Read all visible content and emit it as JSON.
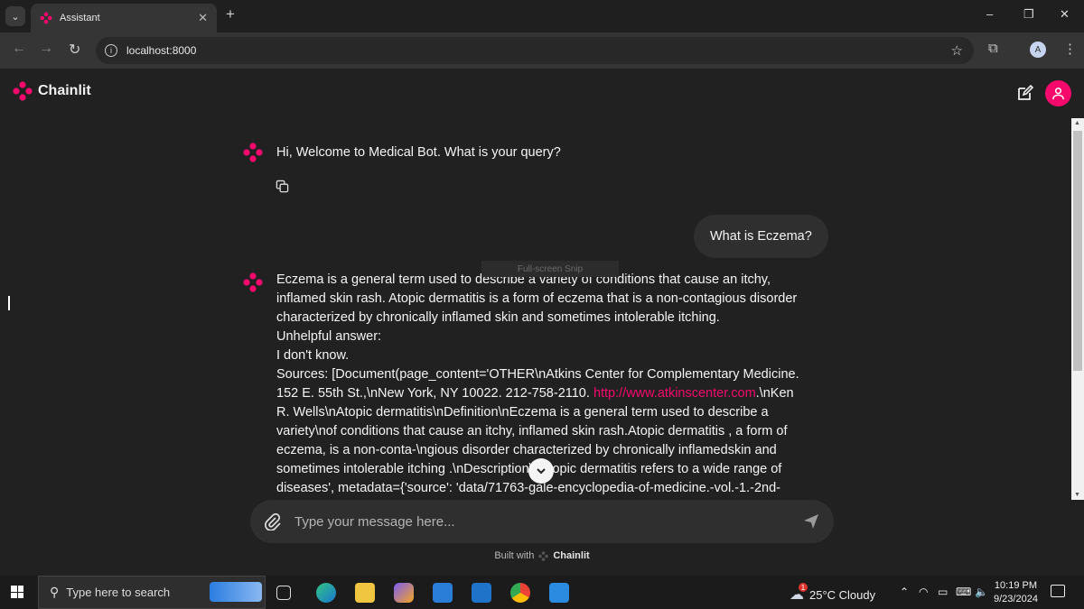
{
  "browser": {
    "tab_title": "Assistant",
    "new_tab": "+",
    "url": "localhost:8000",
    "profile_initial": "A",
    "window_controls": {
      "minimize": "–",
      "restore": "❐",
      "close": "✕"
    }
  },
  "app": {
    "name": "Chainlit",
    "brand_color": "#f50a6c"
  },
  "messages": [
    {
      "role": "assistant",
      "text": "Hi, Welcome to Medical Bot. What is your query?"
    },
    {
      "role": "user",
      "text": "What is Eczema?"
    },
    {
      "role": "assistant",
      "lines": [
        "Eczema is a general term used to describe a variety of conditions that cause an itchy,",
        "inflamed skin rash. Atopic dermatitis is a form of eczema that is a non-contagious disorder",
        "characterized by chronically inflamed skin and sometimes intolerable itching.",
        "Unhelpful answer:",
        "I don't know.",
        "Sources: [Document(page_content='OTHER\\nAtkins Center for Complementary Medicine.",
        "152 E. 55th St.,\\nNew York, NY 10022. 212-758-2110. ",
        "R. Wells\\nAtopic dermatitis\\nDefinition\\nEczema is a general term used to describe a",
        "variety\\nof conditions that cause an itchy, inflamed skin rash.Atopic dermatitis , a form of",
        "eczema, is a non-conta-\\ngious disorder characterized by chronically inflamedskin and",
        "sometimes intolerable itching .\\nDescription\\nAtopic dermatitis refers to a wide range of",
        "diseases', metadata={'source': 'data/71763-gale-encyclopedia-of-medicine.-vol.-1.-2nd-"
      ],
      "link_text": "http://www.atkinscenter.com",
      "link_suffix": ".\\nKen"
    }
  ],
  "overlay": {
    "snip_label": "Full-screen Snip"
  },
  "composer": {
    "placeholder": "Type your message here..."
  },
  "footer": {
    "built_with": "Built with",
    "brand": "Chainlit"
  },
  "taskbar": {
    "search_placeholder": "Type here to search",
    "weather": "25°C  Cloudy",
    "weather_badge": "1",
    "time": "10:19 PM",
    "date": "9/23/2024"
  }
}
